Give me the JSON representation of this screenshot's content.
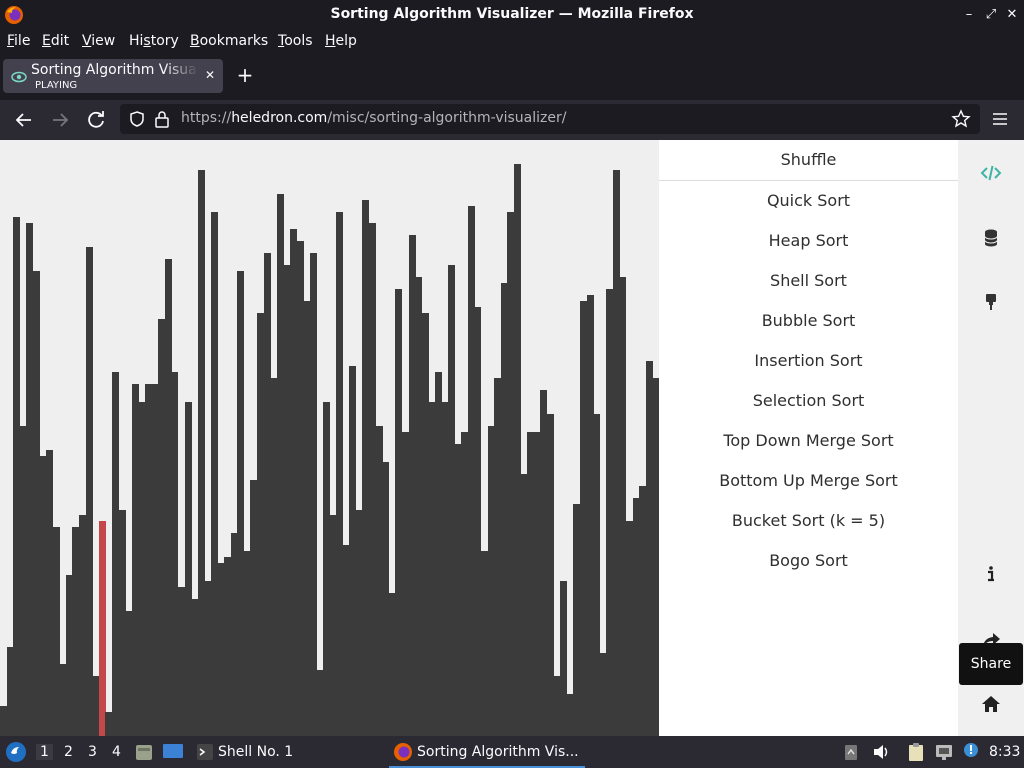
{
  "window": {
    "title": "Sorting Algorithm Visualizer — Mozilla Firefox"
  },
  "menu": {
    "items": [
      {
        "label": "File",
        "ul": "F",
        "rest": "ile"
      },
      {
        "label": "Edit",
        "ul": "E",
        "rest": "dit"
      },
      {
        "label": "View",
        "ul": "V",
        "rest": "iew"
      },
      {
        "label": "History",
        "pre": "Hi",
        "ul": "s",
        "rest": "tory"
      },
      {
        "label": "Bookmarks",
        "ul": "B",
        "rest": "ookmarks"
      },
      {
        "label": "Tools",
        "ul": "T",
        "rest": "ools"
      },
      {
        "label": "Help",
        "ul": "H",
        "rest": "elp"
      }
    ]
  },
  "tab": {
    "title": "Sorting Algorithm Visualizer",
    "status": "PLAYING"
  },
  "address": {
    "scheme": "https://",
    "host": "heledron.com",
    "path": "/misc/sorting-algorithm-visualizer/"
  },
  "panel": {
    "shuffle": "Shuffle",
    "algorithms": [
      "Quick Sort",
      "Heap Sort",
      "Shell Sort",
      "Bubble Sort",
      "Insertion Sort",
      "Selection Sort",
      "Top Down Merge Sort",
      "Bottom Up Merge Sort",
      "Bucket Sort (k = 5)",
      "Bogo Sort"
    ]
  },
  "rail": {
    "share_tooltip": "Share"
  },
  "visualizer": {
    "max": 100,
    "active_index": 15,
    "values": [
      5,
      15,
      87,
      52,
      86,
      78,
      47,
      48,
      35,
      12,
      27,
      35,
      37,
      82,
      10,
      36,
      4,
      61,
      38,
      21,
      59,
      56,
      59,
      59,
      70,
      80,
      61,
      25,
      56,
      23,
      95,
      26,
      88,
      29,
      30,
      34,
      78,
      31,
      43,
      71,
      81,
      60,
      91,
      79,
      85,
      83,
      73,
      81,
      11,
      56,
      37,
      88,
      32,
      62,
      38,
      90,
      86,
      52,
      46,
      24,
      75,
      51,
      84,
      77,
      71,
      56,
      61,
      56,
      79,
      49,
      51,
      89,
      72,
      31,
      52,
      60,
      76,
      88,
      96,
      44,
      51,
      51,
      58,
      54,
      10,
      26,
      7,
      39,
      73,
      74,
      54,
      14,
      75,
      95,
      77,
      36,
      40,
      42,
      63,
      60
    ]
  },
  "taskbar": {
    "workspaces": [
      "1",
      "2",
      "3",
      "4"
    ],
    "terminal_task": "Shell No. 1",
    "firefox_task": "Sorting Algorithm Vis...",
    "time": "8:33"
  }
}
